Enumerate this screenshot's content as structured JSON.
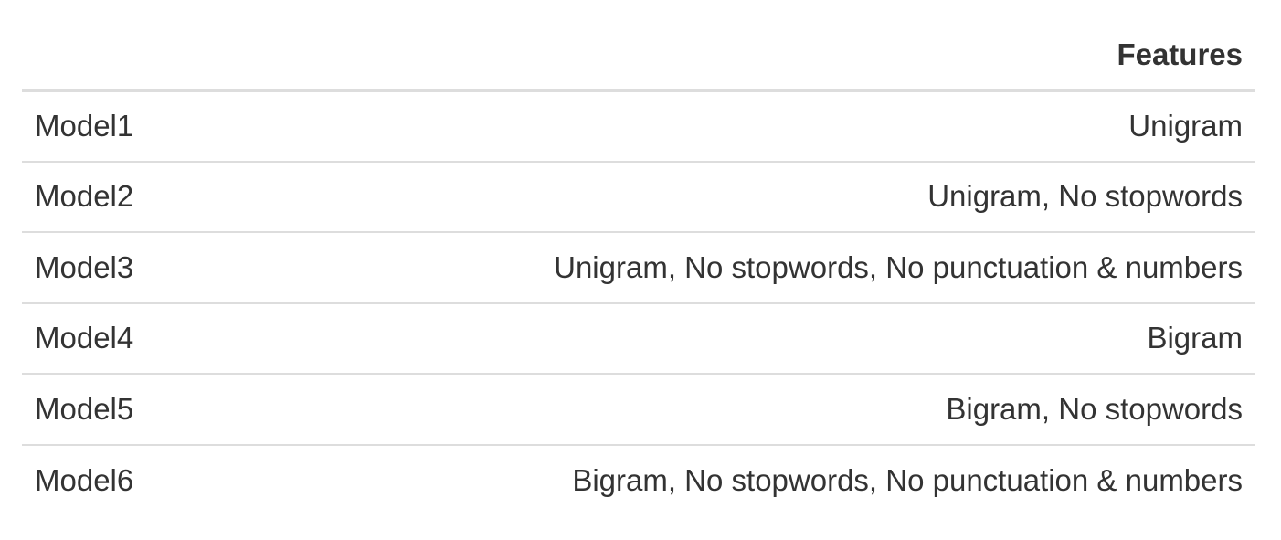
{
  "table": {
    "headers": [
      "",
      "Features"
    ],
    "rows": [
      {
        "model": "Model1",
        "features": "Unigram"
      },
      {
        "model": "Model2",
        "features": "Unigram, No stopwords"
      },
      {
        "model": "Model3",
        "features": "Unigram, No stopwords, No punctuation & numbers"
      },
      {
        "model": "Model4",
        "features": "Bigram"
      },
      {
        "model": "Model5",
        "features": "Bigram, No stopwords"
      },
      {
        "model": "Model6",
        "features": "Bigram, No stopwords, No punctuation & numbers"
      }
    ]
  }
}
